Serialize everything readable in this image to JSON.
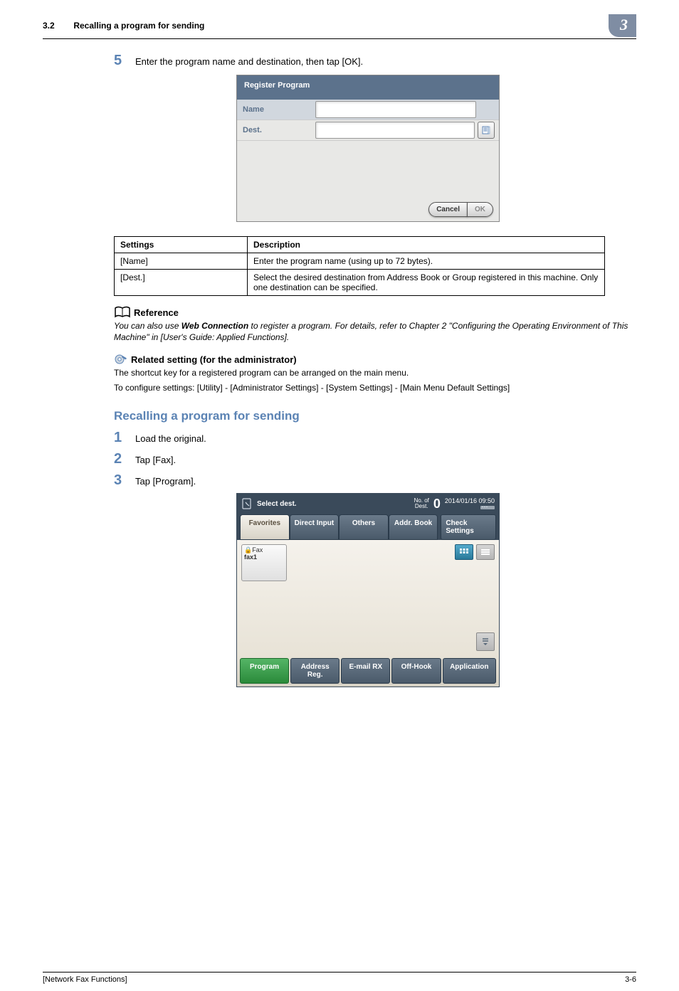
{
  "header": {
    "section_num": "3.2",
    "section_title": "Recalling a program for sending",
    "chapter_badge": "3"
  },
  "step5": {
    "num": "5",
    "text": "Enter the program name and destination, then tap [OK]."
  },
  "shot1": {
    "title": "Register Program",
    "name_label": "Name",
    "dest_label": "Dest.",
    "cancel": "Cancel",
    "ok": "OK"
  },
  "settings_table": {
    "head_settings": "Settings",
    "head_desc": "Description",
    "rows": [
      {
        "setting": "[Name]",
        "desc": "Enter the program name (using up to 72 bytes)."
      },
      {
        "setting": "[Dest.]",
        "desc": "Select the desired destination from Address Book or Group registered in this machine. Only one destination can be specified."
      }
    ]
  },
  "reference": {
    "heading": "Reference",
    "text_pre": "You can also use ",
    "text_bold": "Web Connection",
    "text_post": " to register a program. For details, refer to Chapter 2 \"Configuring the Operating Environment of This Machine\" in [User's Guide: Applied Functions]."
  },
  "related": {
    "heading": "Related setting (for the administrator)",
    "line1": "The shortcut key for a registered program can be arranged on the main menu.",
    "line2": "To configure settings: [Utility] - [Administrator Settings] - [System Settings] - [Main Menu Default Settings]"
  },
  "heading2": "Recalling a program for sending",
  "steps_b": [
    {
      "num": "1",
      "text": "Load the original."
    },
    {
      "num": "2",
      "text": "Tap [Fax]."
    },
    {
      "num": "3",
      "text": "Tap [Program]."
    }
  ],
  "shot2": {
    "title": "Select dest.",
    "count_label": "No. of\nDest.",
    "count_value": "0",
    "timestamp": "2014/01/16 09:50",
    "tabs": {
      "favorites": "Favorites",
      "direct": "Direct Input",
      "others": "Others",
      "addr": "Addr. Book"
    },
    "check_settings": "Check Settings",
    "fav_item": {
      "type": "Fax",
      "label": "fax1"
    },
    "footer": {
      "program": "Program",
      "address_reg": "Address Reg.",
      "email_rx": "E-mail RX",
      "off_hook": "Off-Hook",
      "application": "Application"
    }
  },
  "footer": {
    "left": "[Network Fax Functions]",
    "right": "3-6"
  }
}
